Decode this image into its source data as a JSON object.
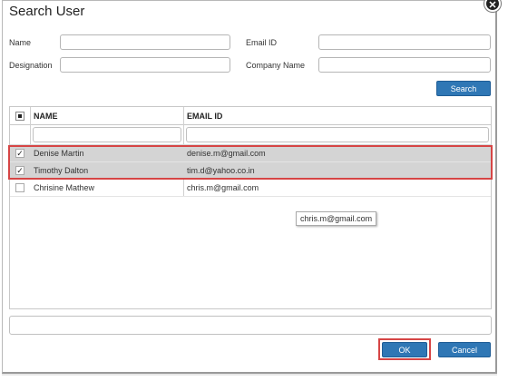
{
  "dialog": {
    "title": "Search User",
    "close_glyph": "✕"
  },
  "form": {
    "name_label": "Name",
    "designation_label": "Designation",
    "email_label": "Email ID",
    "company_label": "Company Name",
    "name_value": "",
    "designation_value": "",
    "email_value": "",
    "company_value": "",
    "search_label": "Search"
  },
  "grid": {
    "columns": [
      "NAME",
      "EMAIL ID"
    ],
    "rows": [
      {
        "name": "Denise Martin",
        "email": "denise.m@gmail.com",
        "checked": true
      },
      {
        "name": "Timothy Dalton",
        "email": "tim.d@yahoo.co.in",
        "checked": true
      },
      {
        "name": "Chrisine Mathew",
        "email": "chris.m@gmail.com",
        "checked": false
      }
    ],
    "check_glyph": "✓"
  },
  "tooltip": {
    "text": "chris.m@gmail.com"
  },
  "footer": {
    "ok_label": "OK",
    "cancel_label": "Cancel"
  },
  "colors": {
    "accent": "#2f77b5",
    "highlight": "#d64545",
    "selected_row": "#d4d4d4"
  }
}
